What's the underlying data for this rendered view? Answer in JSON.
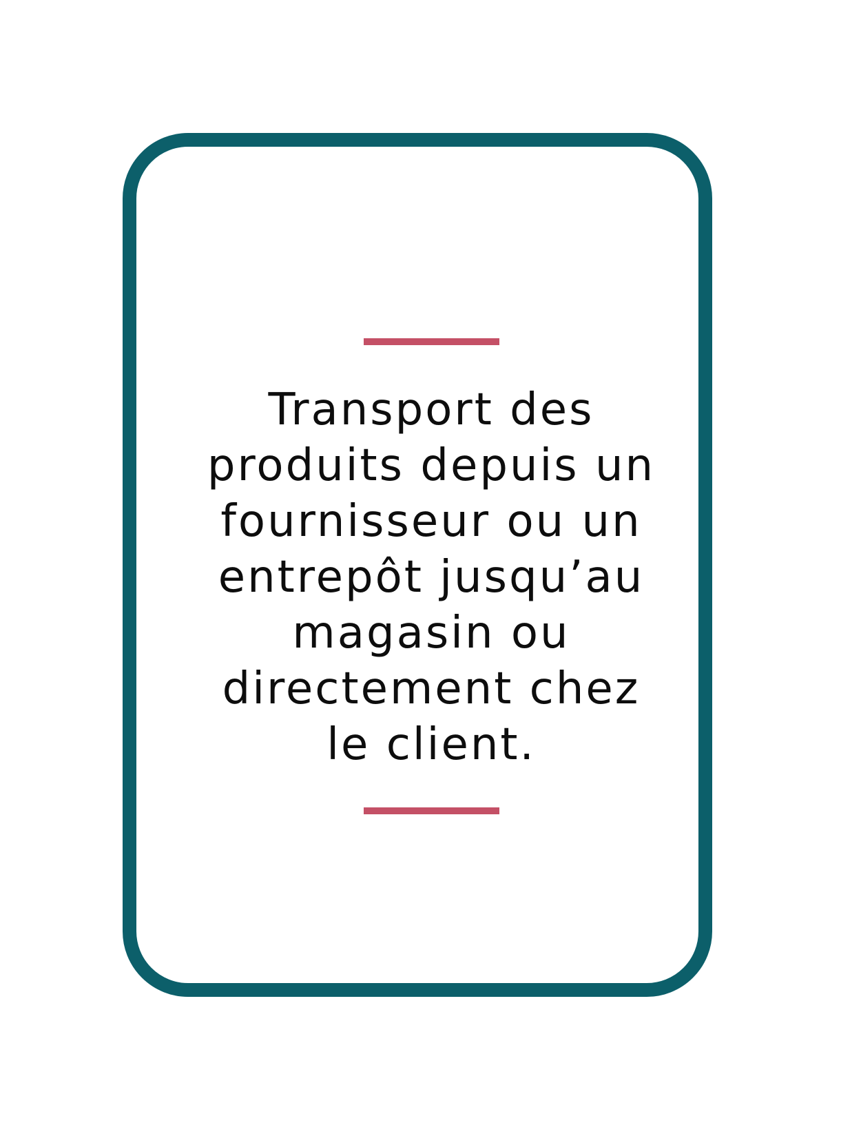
{
  "card": {
    "lines": [
      "Transport des",
      "produits depuis un",
      "fournisseur ou un",
      "entrepôt jusqu’au",
      "magasin ou",
      "directement chez",
      "le client."
    ]
  },
  "colors": {
    "border": "#0c5f6a",
    "accent_rule": "#c45066",
    "text": "#0d0d0d",
    "background": "#ffffff"
  }
}
